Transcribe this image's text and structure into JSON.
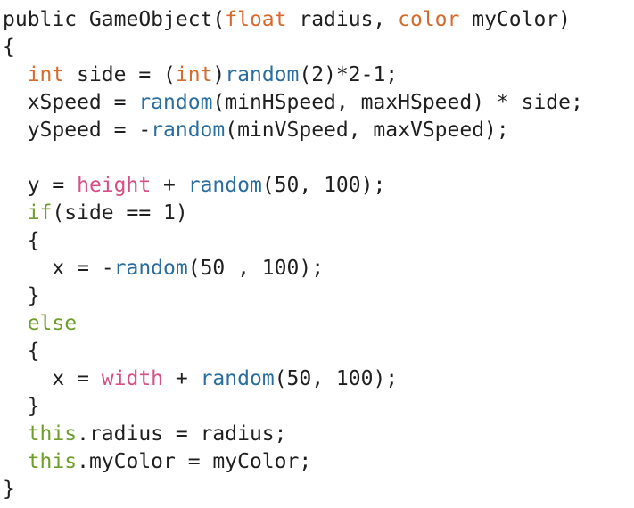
{
  "editor": {
    "language": "Processing/Java",
    "colors": {
      "background": "#ffffff",
      "text": "#1f1f1f",
      "keyword_type": "#d76a2d",
      "function": "#2a6ea0",
      "builtin_variable": "#d64f86",
      "control": "#6f9e2b"
    },
    "lines": [
      [
        {
          "text": "public GameObject(",
          "cls": ""
        },
        {
          "text": "float",
          "cls": "tok-orange"
        },
        {
          "text": " radius, ",
          "cls": ""
        },
        {
          "text": "color",
          "cls": "tok-orange"
        },
        {
          "text": " myColor)",
          "cls": ""
        }
      ],
      [
        {
          "text": "{",
          "cls": ""
        }
      ],
      [
        {
          "text": "  ",
          "cls": ""
        },
        {
          "text": "int",
          "cls": "tok-orange"
        },
        {
          "text": " side = (",
          "cls": ""
        },
        {
          "text": "int",
          "cls": "tok-orange"
        },
        {
          "text": ")",
          "cls": ""
        },
        {
          "text": "random",
          "cls": "tok-blue"
        },
        {
          "text": "(2)*2-1;",
          "cls": ""
        }
      ],
      [
        {
          "text": "  xSpeed = ",
          "cls": ""
        },
        {
          "text": "random",
          "cls": "tok-blue"
        },
        {
          "text": "(minHSpeed, maxHSpeed) * side;",
          "cls": ""
        }
      ],
      [
        {
          "text": "  ySpeed = -",
          "cls": ""
        },
        {
          "text": "random",
          "cls": "tok-blue"
        },
        {
          "text": "(minVSpeed, maxVSpeed);",
          "cls": ""
        }
      ],
      [],
      [
        {
          "text": "  y = ",
          "cls": ""
        },
        {
          "text": "height",
          "cls": "tok-pink"
        },
        {
          "text": " + ",
          "cls": ""
        },
        {
          "text": "random",
          "cls": "tok-blue"
        },
        {
          "text": "(50, 100);",
          "cls": ""
        }
      ],
      [
        {
          "text": "  ",
          "cls": ""
        },
        {
          "text": "if",
          "cls": "tok-green"
        },
        {
          "text": "(side == 1)",
          "cls": ""
        }
      ],
      [
        {
          "text": "  {",
          "cls": ""
        }
      ],
      [
        {
          "text": "    x = -",
          "cls": ""
        },
        {
          "text": "random",
          "cls": "tok-blue"
        },
        {
          "text": "(50 , 100);",
          "cls": ""
        }
      ],
      [
        {
          "text": "  }",
          "cls": ""
        }
      ],
      [
        {
          "text": "  ",
          "cls": ""
        },
        {
          "text": "else",
          "cls": "tok-green"
        }
      ],
      [
        {
          "text": "  {",
          "cls": ""
        }
      ],
      [
        {
          "text": "    x = ",
          "cls": ""
        },
        {
          "text": "width",
          "cls": "tok-pink"
        },
        {
          "text": " + ",
          "cls": ""
        },
        {
          "text": "random",
          "cls": "tok-blue"
        },
        {
          "text": "(50, 100);",
          "cls": ""
        }
      ],
      [
        {
          "text": "  }",
          "cls": ""
        }
      ],
      [
        {
          "text": "  ",
          "cls": ""
        },
        {
          "text": "this",
          "cls": "tok-green"
        },
        {
          "text": ".radius = radius;",
          "cls": ""
        }
      ],
      [
        {
          "text": "  ",
          "cls": ""
        },
        {
          "text": "this",
          "cls": "tok-green"
        },
        {
          "text": ".myColor = myColor;",
          "cls": ""
        }
      ],
      [
        {
          "text": "}",
          "cls": ""
        }
      ]
    ]
  }
}
